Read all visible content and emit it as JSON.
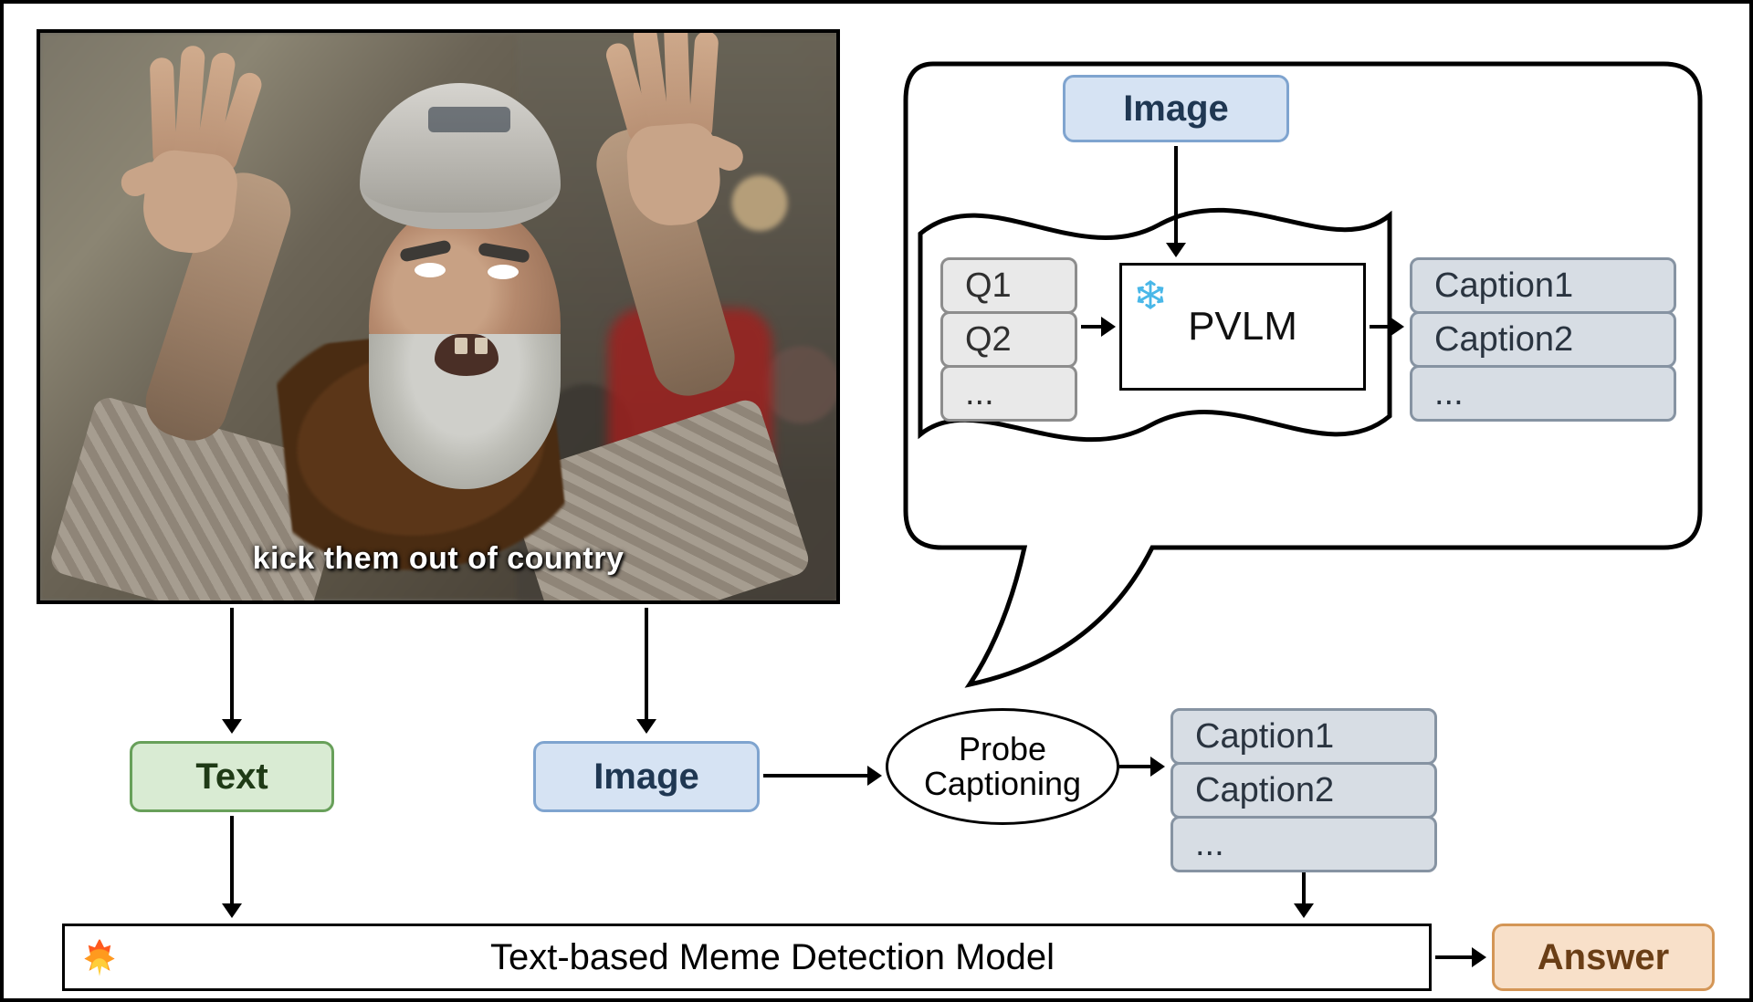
{
  "meme_caption": "kick them out of country",
  "nodes": {
    "text": "Text",
    "image": "Image",
    "answer": "Answer",
    "probe_line1": "Probe",
    "probe_line2": "Captioning",
    "pvlm": "PVLM",
    "model": "Text-based Meme Detection Model"
  },
  "qstack": [
    "Q1",
    "Q2",
    "..."
  ],
  "caption_stack": [
    "Caption1",
    "Caption2",
    "..."
  ],
  "icons": {
    "fire": "fire-icon",
    "snowflake": "snowflake-icon"
  }
}
